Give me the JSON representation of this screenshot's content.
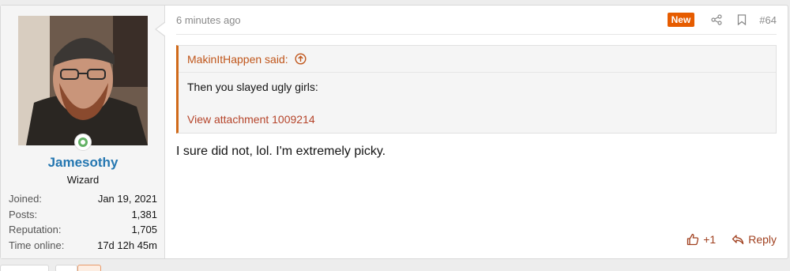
{
  "user": {
    "name": "Jamesothy",
    "title": "Wizard",
    "stats": [
      {
        "label": "Joined:",
        "value": "Jan 19, 2021"
      },
      {
        "label": "Posts:",
        "value": "1,381"
      },
      {
        "label": "Reputation:",
        "value": "1,705"
      },
      {
        "label": "Time online:",
        "value": "17d 12h 45m"
      }
    ]
  },
  "post": {
    "date": "6 minutes ago",
    "badge": "New",
    "number": "#64",
    "quote": {
      "author": "MakinItHappen said:",
      "text": "Then you slayed ugly girls:",
      "attachment": "View attachment 1009214"
    },
    "body": "I sure did not, lol. I'm extremely picky.",
    "like_count": "+1",
    "reply_label": "Reply"
  },
  "colors": {
    "accent": "#c0561b",
    "username": "#2577b1",
    "badge": "#e65c00",
    "online": "#63b265"
  }
}
